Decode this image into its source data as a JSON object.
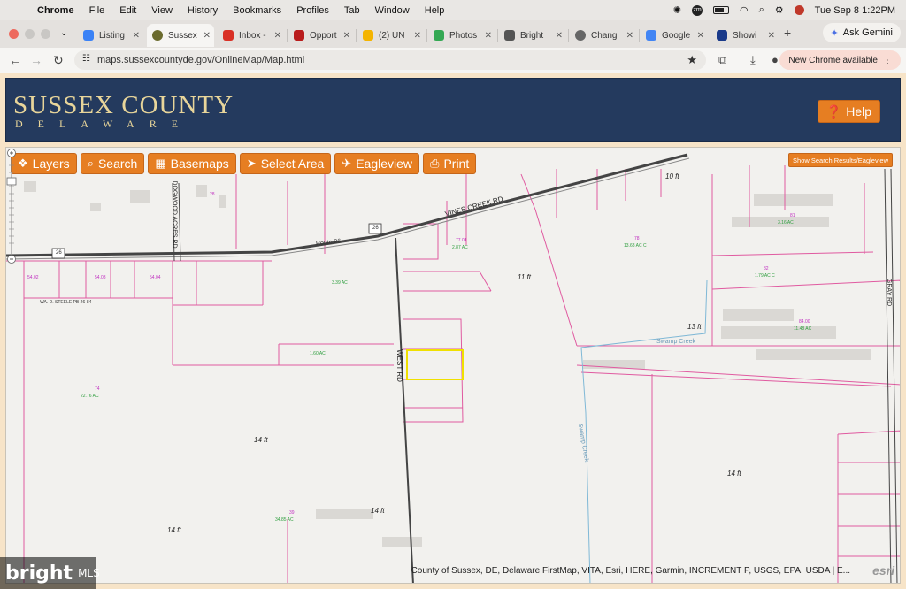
{
  "menubar": {
    "app": "Chrome",
    "items": [
      "File",
      "Edit",
      "View",
      "History",
      "Bookmarks",
      "Profiles",
      "Tab",
      "Window",
      "Help"
    ],
    "datetime": "Tue Sep 8  1:22PM"
  },
  "tabs": [
    {
      "label": "Listing",
      "color": "#3b82f6"
    },
    {
      "label": "Sussex",
      "color": "#6b6b2e"
    },
    {
      "label": "Inbox -",
      "color": "#d93025"
    },
    {
      "label": "Opport",
      "color": "#b91c1c"
    },
    {
      "label": "(2) UN",
      "color": "#f4b400"
    },
    {
      "label": "Photos",
      "color": "#34a853"
    },
    {
      "label": "Bright",
      "color": "#555555"
    },
    {
      "label": "Chang",
      "color": "#666666"
    },
    {
      "label": "Google",
      "color": "#4285f4"
    },
    {
      "label": "Showi",
      "color": "#1a3a8a"
    }
  ],
  "gemini_label": "Ask Gemini",
  "address": {
    "url": "maps.sussexcountyde.gov/OnlineMap/Map.html",
    "new_chrome": "New Chrome available"
  },
  "header": {
    "title": "SUSSEX COUNTY",
    "subtitle": "DELAWARE",
    "help_label": "Help"
  },
  "toolbar": {
    "layers": "Layers",
    "search": "Search",
    "basemaps": "Basemaps",
    "select_area": "Select Area",
    "eagleview": "Eagleview",
    "print": "Print",
    "show_search": "Show Search Results/Eagleview"
  },
  "map": {
    "roads": {
      "vines_creek": "VINES CREEK RD",
      "dogwood": "DOGWOOD ACRES RD",
      "west_rd": "WEST RD",
      "gray_rd": "GRAY RD",
      "route26": "Route 26",
      "shield": "26",
      "wa_steele": "WA. D. STEELE PB 26-84",
      "swamp_creek": "Swamp Creek",
      "swamp_creek_2": "Swamp Creek"
    },
    "elevations": [
      "10 ft",
      "11 ft",
      "13 ft",
      "14 ft",
      "14 ft",
      "14 ft",
      "14 ft"
    ],
    "parcels": [
      "77.01",
      "78",
      "81",
      "82",
      "84.00",
      "74",
      "28",
      "39",
      "54.02",
      "54.03",
      "54.04"
    ],
    "acreage": [
      "2.87 AC",
      "13.68 AC C",
      "3.39 AC",
      "1.60 AC",
      "1.79 AC C",
      "11.48 AC",
      "3.16 AC",
      "22.76 AC",
      "34.85 AC"
    ],
    "attribution": "County of Sussex, DE, Delaware FirstMap, VITA, Esri, HERE, Garmin, INCREMENT P, USGS, EPA, USDA | E...",
    "esri": "esri"
  },
  "watermark": {
    "brand": "bright",
    "mls": "MLS"
  }
}
